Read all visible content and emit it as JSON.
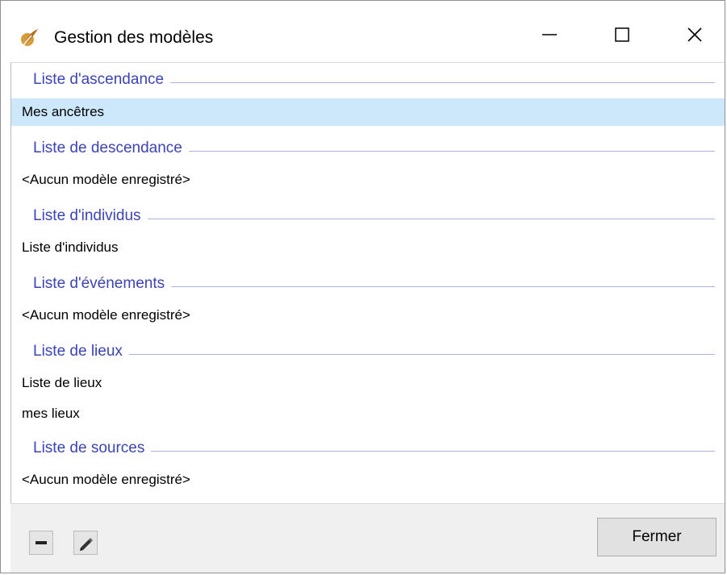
{
  "window": {
    "title": "Gestion des modèles",
    "icon": "feather-icon",
    "controls": [
      "minimize-icon",
      "maximize-icon",
      "close-icon"
    ]
  },
  "sections": [
    {
      "label": "Liste d'ascendance",
      "items": [
        "Mes ancêtres"
      ],
      "selected_item": "Mes ancêtres"
    },
    {
      "label": "Liste de descendance",
      "items": [
        "<Aucun modèle enregistré>"
      ]
    },
    {
      "label": "Liste d'individus",
      "items": [
        "Liste d'individus"
      ]
    },
    {
      "label": "Liste d'événements",
      "items": [
        "<Aucun modèle enregistré>"
      ]
    },
    {
      "label": "Liste de lieux",
      "items": [
        "Liste de lieux",
        "mes lieux"
      ]
    },
    {
      "label": "Liste de sources",
      "items": [
        "<Aucun modèle enregistré>"
      ]
    }
  ],
  "footer": {
    "remove_icon": "minus-icon",
    "edit_icon": "pencil-icon",
    "close_label": "Fermer"
  },
  "colors": {
    "section_text": "#3b43b8",
    "selection": "#cde8fb",
    "footer_bg": "#f0f0f0"
  }
}
